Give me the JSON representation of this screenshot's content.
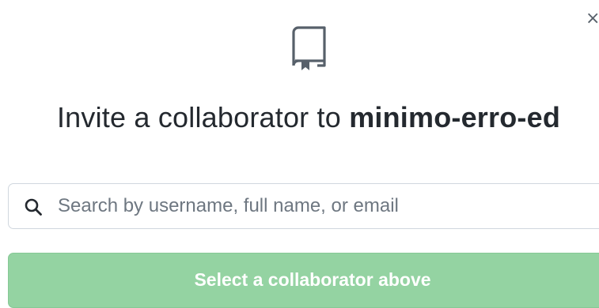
{
  "dialog": {
    "close_glyph": "×",
    "title_prefix": "Invite a collaborator to ",
    "repo_name": "minimo-erro-ed",
    "icons": {
      "header": "repo-icon",
      "search": "search-icon",
      "close": "close-icon"
    }
  },
  "search": {
    "value": "",
    "placeholder": "Search by username, full name, or email"
  },
  "submit": {
    "label": "Select a collaborator above",
    "enabled": false
  },
  "colors": {
    "button_bg_disabled": "#94d3a2",
    "text": "#24292f",
    "border": "#d0d7de"
  }
}
